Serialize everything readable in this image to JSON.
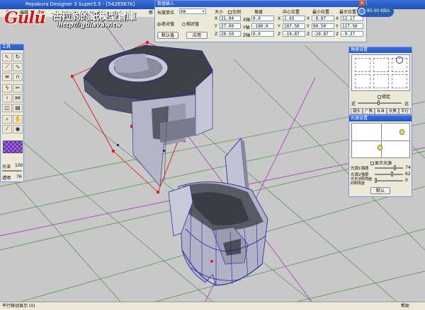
{
  "window": {
    "title": "Pepakura Designer 3  Super5.5 - [5426567k]"
  },
  "menubar": {
    "items": [
      "文件",
      "编辑",
      "帮"
    ]
  },
  "logo": {
    "brand": "Gulu",
    "tw": ".tw",
    "name": "古拉豹的紙模型倉庫",
    "url": "http://gulavaw.tw"
  },
  "numeric_panel": {
    "title": "数值输入",
    "unit_label": "长度单位",
    "unit_value": "mm",
    "absolute_label": "绝对值",
    "relative_label": "相对值",
    "default_button": "默认值",
    "apply_button": "应用",
    "size_header": "大小",
    "ratio_label": "比例",
    "angle_header": "角度",
    "center_header": "中心位置",
    "min_header": "最小位置",
    "max_header": "最大位置",
    "rows": [
      {
        "axis": "X",
        "size": "21.04",
        "angle_axis": "X轴",
        "angle": "0.0",
        "center": "1.65",
        "min": "-8.87",
        "max": "12.17"
      },
      {
        "axis": "Y",
        "size": "27.00",
        "angle_axis": "Y轴",
        "angle": "-180.0",
        "center": "107.50",
        "min": "90.50",
        "max": "117.50"
      },
      {
        "axis": "Z",
        "size": "20.50",
        "angle_axis": "Z轴",
        "angle": "0.0",
        "center": "-19.87",
        "min": "-29.87",
        "max": "-9.37"
      }
    ]
  },
  "speed_indicator": {
    "value": "85.00 KB/s"
  },
  "tools": {
    "title": "工具",
    "light_label": "光泽",
    "light_value": "100",
    "alpha_label": "透明",
    "alpha_value": "76"
  },
  "angle_panel": {
    "title": "角度设置",
    "lock_label": "锁定",
    "near_label": "近",
    "far_label": "远",
    "tabs": [
      "镜头",
      "广角",
      "标准",
      "长焦",
      "平行"
    ],
    "active_tab": "标准"
  },
  "light_panel": {
    "title": "光源设置",
    "show_light_label": "显示光源",
    "rows": [
      {
        "label": "光源1强度",
        "value": "74",
        "level": 0.74
      },
      {
        "label": "光源2强度",
        "value": "62",
        "level": 0.62
      },
      {
        "label": "光无法照亮面的明亮度",
        "value": "0",
        "level": 0
      }
    ],
    "default_button": "默认"
  },
  "statusbar": {
    "left_text": "平行移动显示 (0)",
    "right_text": "帮助"
  },
  "colors": {
    "titlebar": "#2458c8",
    "panel_bg": "#ece9d8",
    "viewport_bg": "#c8c8c8",
    "grid_green": "#4f8f4f",
    "grid_purple": "#b040c0",
    "model_face": "#a8a8c0",
    "model_dark": "#4a4a55",
    "edge_blue": "#2020a0",
    "bbox_red": "#e02020"
  }
}
